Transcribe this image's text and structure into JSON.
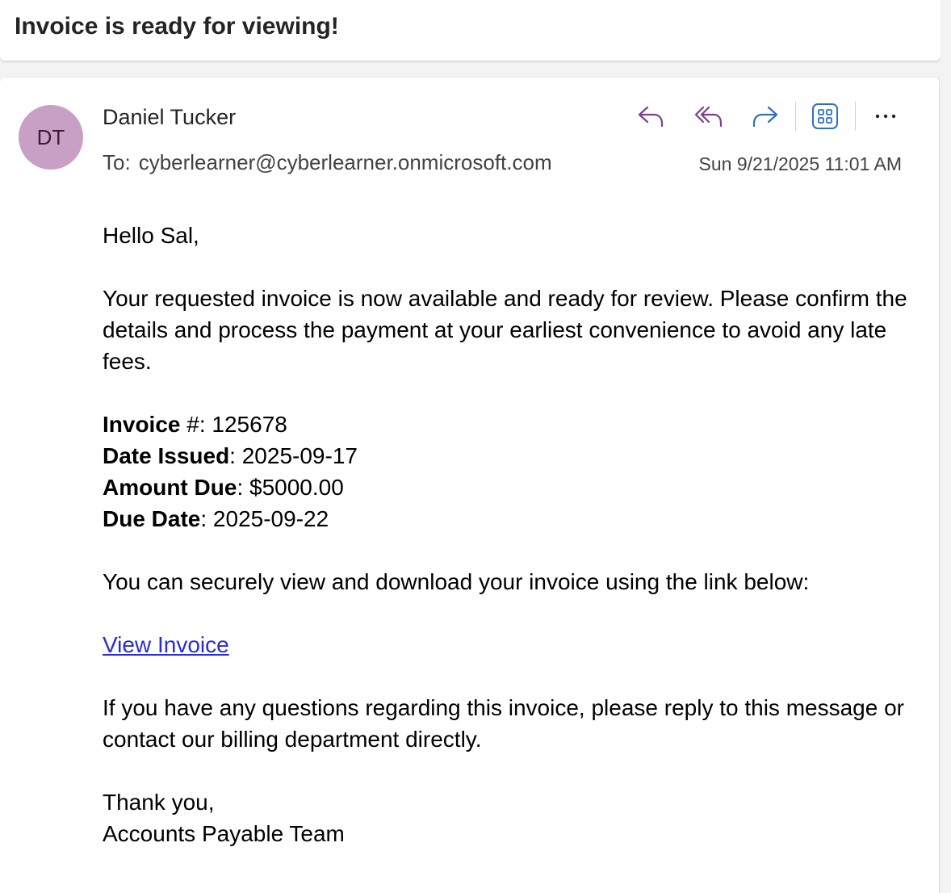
{
  "subject": "Invoice is ready for viewing!",
  "message": {
    "avatar_initials": "DT",
    "sender_name": "Daniel Tucker",
    "to_label": "To:",
    "to_address": "cyberlearner@cyberlearner.onmicrosoft.com",
    "date": "Sun 9/21/2025 11:01 AM",
    "toolbar": {
      "reply_icon": "reply-icon",
      "reply_all_icon": "reply-all-icon",
      "forward_icon": "forward-icon",
      "apps_icon": "apps-icon",
      "more_icon": "more-icon",
      "reply_color": "#7b3f8f",
      "forward_color": "#2f6fc4"
    },
    "body": {
      "greeting": "Hello Sal,",
      "intro": "Your requested invoice is now available and ready for review. Please confirm the details and process the payment at your earliest convenience to avoid any late fees.",
      "details": [
        {
          "label": "Invoice",
          "suffix": " #",
          "value": ": 125678"
        },
        {
          "label": "Date Issued",
          "suffix": "",
          "value": ": 2025-09-17"
        },
        {
          "label": "Amount Due",
          "suffix": "",
          "value": ": $5000.00"
        },
        {
          "label": "Due Date",
          "suffix": "",
          "value": ": 2025-09-22"
        }
      ],
      "link_intro": "You can securely view and download your invoice using the link below:",
      "link_text": "View Invoice",
      "questions": "If you have any questions regarding this invoice, please reply to this message or contact our billing department directly.",
      "closing": "Thank you,",
      "signature": "Accounts Payable Team"
    }
  }
}
